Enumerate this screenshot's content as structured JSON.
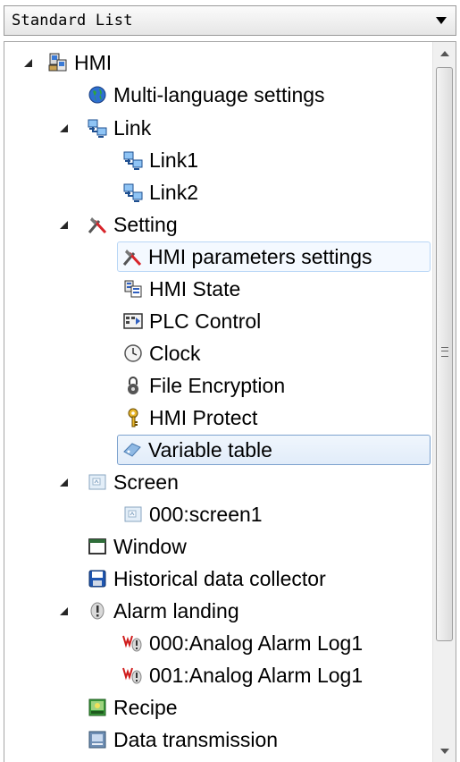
{
  "dropdown": {
    "label": "Standard List"
  },
  "tree": [
    {
      "label": "HMI",
      "icon": "hmi-icon",
      "expanded": true
    },
    {
      "label": "Multi-language settings",
      "icon": "globe-icon"
    },
    {
      "label": "Link",
      "icon": "network-icon",
      "expanded": true
    },
    {
      "label": "Link1",
      "icon": "network-icon"
    },
    {
      "label": "Link2",
      "icon": "network-icon"
    },
    {
      "label": "Setting",
      "icon": "tools-icon",
      "expanded": true
    },
    {
      "label": "HMI parameters settings",
      "icon": "tools-icon",
      "state": "hover"
    },
    {
      "label": "HMI State",
      "icon": "state-icon"
    },
    {
      "label": "PLC Control",
      "icon": "plc-icon"
    },
    {
      "label": "Clock",
      "icon": "clock-icon"
    },
    {
      "label": "File Encryption",
      "icon": "lock-icon"
    },
    {
      "label": "HMI Protect",
      "icon": "key-icon"
    },
    {
      "label": "Variable table",
      "icon": "tag-icon",
      "state": "selected"
    },
    {
      "label": "Screen",
      "icon": "screen-icon",
      "expanded": true
    },
    {
      "label": "000:screen1",
      "icon": "screen-icon"
    },
    {
      "label": "Window",
      "icon": "window-icon"
    },
    {
      "label": "Historical data collector",
      "icon": "save-icon"
    },
    {
      "label": "Alarm landing",
      "icon": "alarm-icon",
      "expanded": true
    },
    {
      "label": "000:Analog Alarm Log1",
      "icon": "alarm-log-icon"
    },
    {
      "label": "001:Analog Alarm Log1",
      "icon": "alarm-log-icon"
    },
    {
      "label": "Recipe",
      "icon": "recipe-icon"
    },
    {
      "label": "Data transmission",
      "icon": "transmission-icon"
    }
  ]
}
